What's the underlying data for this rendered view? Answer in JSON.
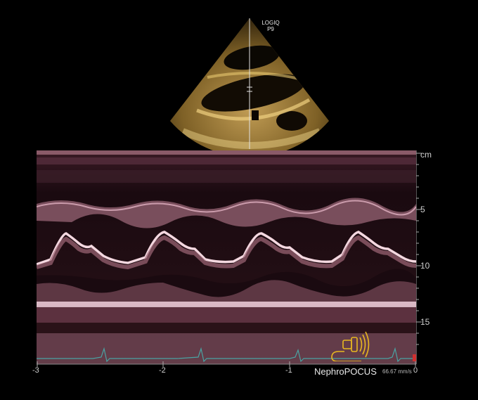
{
  "echo_sector": {
    "brand_line1": "LOGIQ",
    "brand_line2": "P9"
  },
  "depth_scale": {
    "unit": "cm",
    "labels": [
      "5",
      "10",
      "15"
    ]
  },
  "time_axis": {
    "labels": [
      "-3",
      "-2",
      "-1",
      "0"
    ]
  },
  "watermark": "NephroPOCUS",
  "sweep_speed": "66.67 mm/s",
  "colors": {
    "mmode_tint": "#c98a9c",
    "bmode_tint": "#c9a04a",
    "ecg_trace": "#4aa3a3",
    "logo_color": "#e8b820"
  }
}
